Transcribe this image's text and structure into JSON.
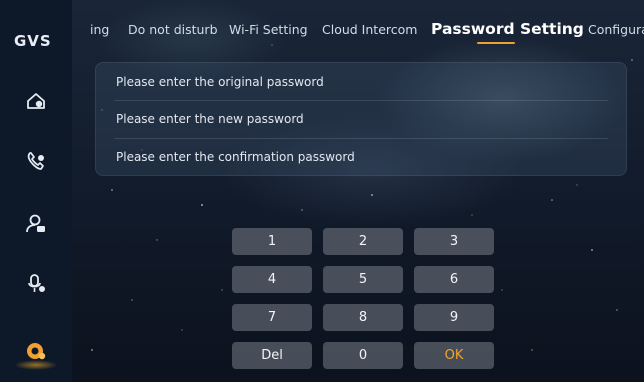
{
  "sidebar": {
    "logo": "GVS",
    "items": [
      {
        "icon": "home-monitor-icon"
      },
      {
        "icon": "call-icon"
      },
      {
        "icon": "user-camera-icon"
      },
      {
        "icon": "microphone-icon"
      },
      {
        "icon": "settings-icon",
        "active": true
      }
    ]
  },
  "tabs": [
    {
      "label": "ing"
    },
    {
      "label": "Do not disturb"
    },
    {
      "label": "Wi-Fi Setting"
    },
    {
      "label": "Cloud Intercom"
    },
    {
      "label": "Password Setting",
      "active": true
    },
    {
      "label": "Configura"
    }
  ],
  "form": {
    "original_password_placeholder": "Please enter the original password",
    "new_password_placeholder": "Please enter the new password",
    "confirm_password_placeholder": "Please enter the confirmation password"
  },
  "keypad": {
    "keys": [
      "1",
      "2",
      "3",
      "4",
      "5",
      "6",
      "7",
      "8",
      "9",
      "Del",
      "0",
      "OK"
    ]
  },
  "colors": {
    "accent": "#f0a030",
    "sidebar_bg": "#0d1828"
  }
}
